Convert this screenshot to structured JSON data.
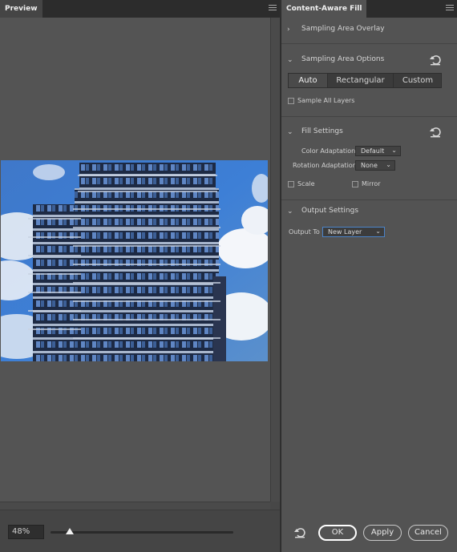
{
  "preview": {
    "tab_label": "Preview",
    "zoom_value": "48%",
    "zoom_fraction": 0.1,
    "image_alt": "Apartment tower against blue sky with clouds"
  },
  "panel": {
    "tab_label": "Content-Aware Fill",
    "sections": {
      "sampling_overlay": {
        "title": "Sampling Area Overlay",
        "expanded": false
      },
      "sampling_options": {
        "title": "Sampling Area Options",
        "expanded": true,
        "modes": [
          "Auto",
          "Rectangular",
          "Custom"
        ],
        "selected_mode": "Auto",
        "sample_all_layers_label": "Sample All Layers",
        "sample_all_layers_checked": false
      },
      "fill_settings": {
        "title": "Fill Settings",
        "expanded": true,
        "color_adaptation_label": "Color Adaptation",
        "color_adaptation_value": "Default",
        "rotation_adaptation_label": "Rotation Adaptation",
        "rotation_adaptation_value": "None",
        "scale_label": "Scale",
        "scale_checked": false,
        "mirror_label": "Mirror",
        "mirror_checked": false
      },
      "output_settings": {
        "title": "Output Settings",
        "expanded": true,
        "output_to_label": "Output To",
        "output_to_value": "New Layer"
      }
    },
    "buttons": {
      "ok": "OK",
      "apply": "Apply",
      "cancel": "Cancel"
    }
  },
  "colors": {
    "focus_accent": "#4b84c9",
    "panel_bg": "#535353",
    "preview_bg": "#545454"
  }
}
